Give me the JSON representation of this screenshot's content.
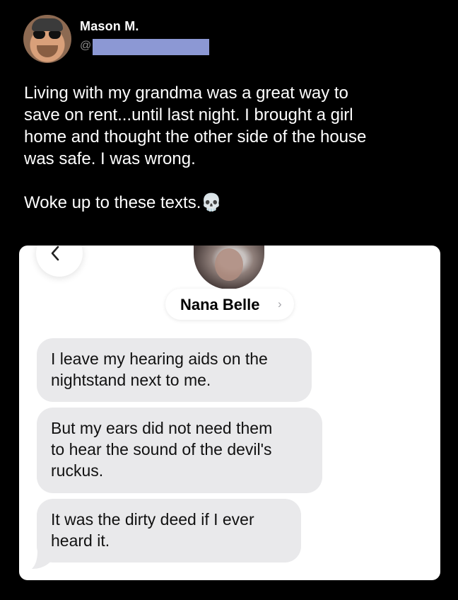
{
  "tweet": {
    "author_name": "Mason M.",
    "handle_prefix": "@",
    "body": "Living with my grandma was a great way to\nsave on rent...until last night. I brought a girl\nhome and thought the other side of the house\nwas safe. I was wrong.\n\nWoke up to these texts.💀"
  },
  "screenshot": {
    "contact_name": "Nana Belle",
    "chevron": "›",
    "messages": [
      "I leave my hearing aids on the\nnightstand next to me.",
      "But my ears did not need them\nto hear the sound of the devil's\nruckus.",
      "It was the dirty deed if I ever\nheard it."
    ]
  },
  "colors": {
    "background": "#000000",
    "bubble": "#e9e9eb",
    "redaction": "#8c98d4",
    "handle": "#8b8b8b"
  }
}
